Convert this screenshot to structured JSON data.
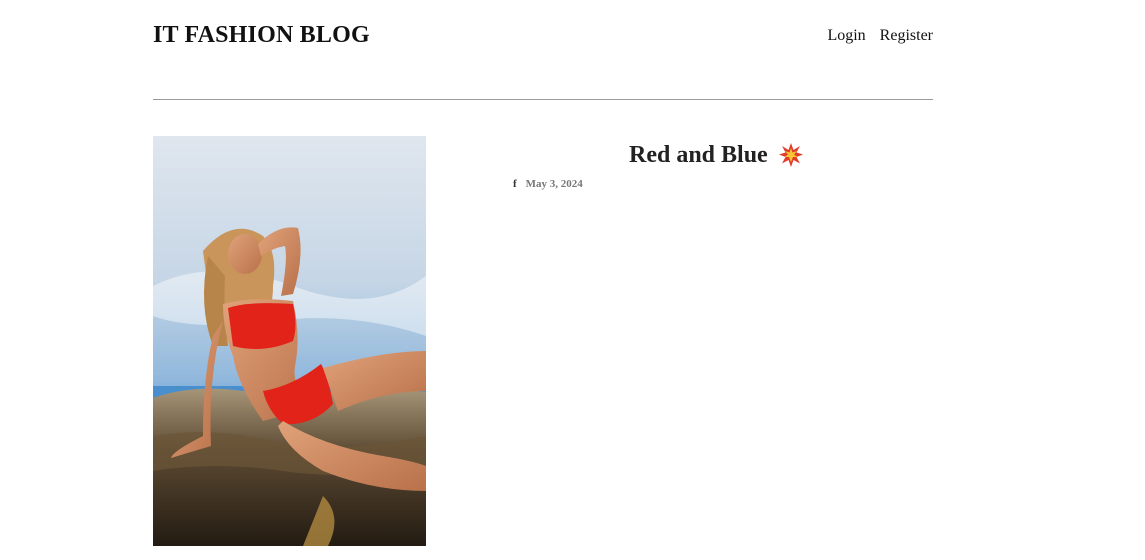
{
  "header": {
    "site_title": "IT FASHION BLOG",
    "nav": {
      "login_label": "Login",
      "register_label": "Register"
    }
  },
  "post": {
    "title": "Red and Blue",
    "title_icon": "collision-burst-icon",
    "author_icon": "facebook-icon",
    "author_initial": "f",
    "date": "May 3, 2024",
    "photo": {
      "subject": "woman in red bikini on rocks",
      "colors": {
        "sky": "#8fb7dc",
        "swimsuit": "#e2231a",
        "rock": "#3a3024"
      }
    }
  },
  "colors": {
    "text": "#222222",
    "meta": "#777777",
    "divider": "#9a9a9a",
    "background": "#ffffff"
  }
}
